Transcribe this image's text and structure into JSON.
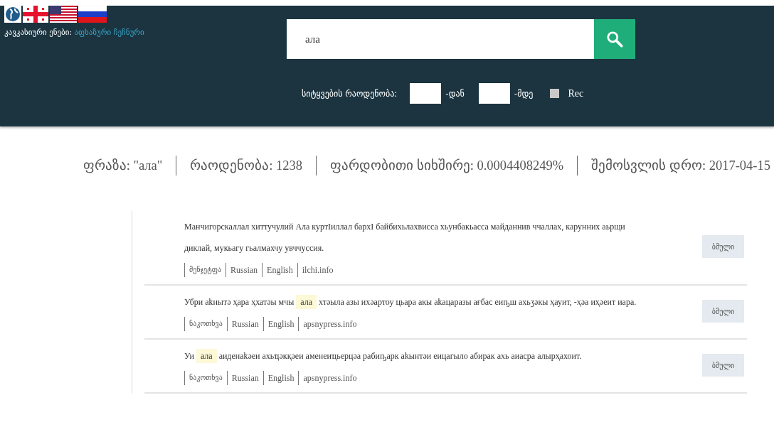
{
  "header": {
    "languages_label": "კავკასიური ენები:",
    "languages_link": "აფხაზური ჩეჩნური",
    "search": {
      "value": "ала"
    },
    "filter": {
      "label": "სიტყვების რაოდენობა:",
      "from_suffix": "-დან",
      "to_suffix": "-მდე",
      "rec": {
        "label": "Rec",
        "checked": false
      }
    }
  },
  "stats": [
    "ფრაზა: \"ала\"",
    "რაოდენობა: 1238",
    "ფარდობითი სიხშირე: 0.0004408249%",
    "შემოსვლის დრო: 2017-04-15"
  ],
  "results": [
    {
      "segments": [
        {
          "text": "Манчигорскаллал хиттучулий Ала куртIиллал бархI байбихьлахвисса хьунбакьасса майданнив ччаллах, карунних аьрщи диклай, мукьагу гьалмахчу увччуссия.",
          "highlighted": false
        }
      ],
      "sources": [
        "მენჯეტფა",
        "Russian",
        "English",
        "ilchi.info"
      ],
      "button": "ბმული"
    },
    {
      "segments": [
        {
          "text": "Убри аҟнытә ҳара ҳхатәы мчы",
          "highlighted": false
        },
        {
          "text": "ала",
          "highlighted": true
        },
        {
          "text": "хтәыла азы ихәартоу цьара акы аҟацаразы ағбас еиҧш ахьӡәкы ҳауит, -ҳәа иҳәеит иара.",
          "highlighted": false
        }
      ],
      "sources": [
        "ნაკოთხვა",
        "Russian",
        "English",
        "apsnypress.info"
      ],
      "button": "ბმული"
    },
    {
      "segments": [
        {
          "text": "Уи",
          "highlighted": false
        },
        {
          "text": "ала",
          "highlighted": true
        },
        {
          "text": "аиденаҟәеи ахьҵәкқәеи аменеиҵьерцәа рабиҧарк аҟынтәи еицагыло абирак ахь аиасра алырҳахоит.",
          "highlighted": false
        }
      ],
      "sources": [
        "ნაკოთხვა",
        "Russian",
        "English",
        "apsnypress.info"
      ],
      "button": "ბმული"
    }
  ]
}
